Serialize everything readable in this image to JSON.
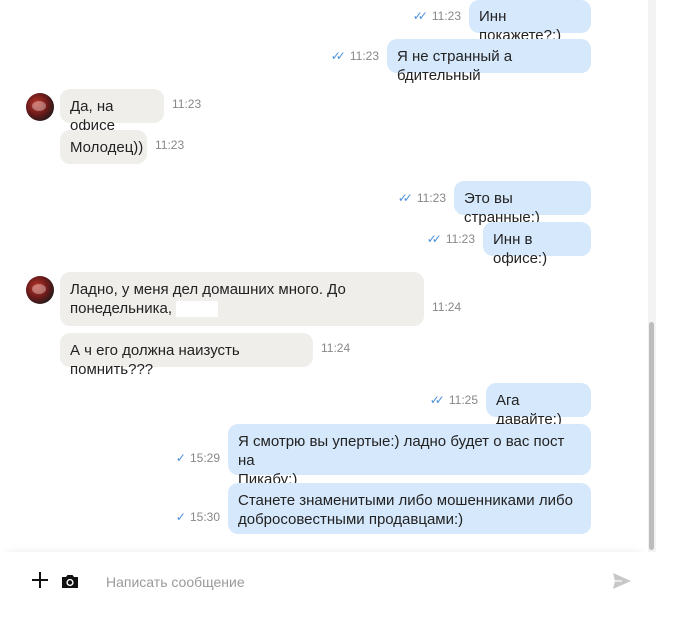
{
  "messages": [
    {
      "dir": "out",
      "text": "Инн покажете?:)",
      "time": "11:23",
      "read": true
    },
    {
      "dir": "out",
      "text": "Я не странный а бдительный",
      "time": "11:23",
      "read": true
    },
    {
      "dir": "in",
      "text": "Да, на офисе",
      "time": "11:23",
      "avatar": true
    },
    {
      "dir": "in",
      "text": "Молодец))",
      "time": "11:23"
    },
    {
      "dir": "out",
      "text": "Это вы странные:)",
      "time": "11:23",
      "read": true
    },
    {
      "dir": "out",
      "text": "Инн в офисе:)",
      "time": "11:23",
      "read": true
    },
    {
      "dir": "in",
      "text_line1": "Ладно, у меня дел домашних много. До",
      "text_line2": "понедельника,",
      "time": "11:24",
      "avatar": true
    },
    {
      "dir": "in",
      "text": "А ч его должна наизусть помнить???",
      "time": "11:24"
    },
    {
      "dir": "out",
      "text": "Ага давайте:)",
      "time": "11:25",
      "read": true
    },
    {
      "dir": "out",
      "text_line1": "Я смотрю вы упертые:) ладно будет о вас пост на",
      "text_line2": "Пикабу:)",
      "time": "15:29",
      "read": false
    },
    {
      "dir": "out",
      "text_line1": "Станете знаменитыми либо мошенниками либо",
      "text_line2": "добросовестными продавцами:)",
      "time": "15:30",
      "read": false
    }
  ],
  "composer": {
    "placeholder": "Написать сообщение"
  },
  "icons": {
    "add": "plus-icon",
    "camera": "camera-icon",
    "send": "send-icon",
    "read_double": "double-check-icon",
    "delivered": "single-check-icon"
  },
  "colors": {
    "outgoing_bubble": "#d6e8fb",
    "incoming_bubble": "#efeeeb",
    "check": "#4a90d9"
  }
}
